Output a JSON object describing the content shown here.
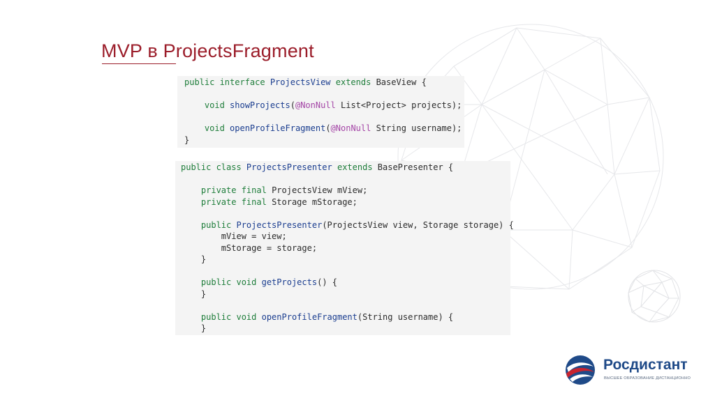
{
  "slide": {
    "title": "MVP в ProjectsFragment"
  },
  "code_block_1": [
    [
      [
        "kw",
        "public interface "
      ],
      [
        "tp",
        "ProjectsView"
      ],
      [
        "kw",
        " extends "
      ],
      [
        "p",
        "BaseView {"
      ]
    ],
    [],
    [
      [
        "p",
        "    "
      ],
      [
        "kw",
        "void "
      ],
      [
        "fn",
        "showProjects"
      ],
      [
        "p",
        "("
      ],
      [
        "an",
        "@NonNull"
      ],
      [
        "p",
        " List<Project> projects);"
      ]
    ],
    [],
    [
      [
        "p",
        "    "
      ],
      [
        "kw",
        "void "
      ],
      [
        "fn",
        "openProfileFragment"
      ],
      [
        "p",
        "("
      ],
      [
        "an",
        "@NonNull"
      ],
      [
        "p",
        " String username);"
      ]
    ],
    [
      [
        "p",
        "}"
      ]
    ]
  ],
  "code_block_2": [
    [
      [
        "kw",
        "public class "
      ],
      [
        "tp",
        "ProjectsPresenter"
      ],
      [
        "kw",
        " extends "
      ],
      [
        "p",
        "BasePresenter {"
      ]
    ],
    [],
    [
      [
        "p",
        "    "
      ],
      [
        "kw",
        "private final "
      ],
      [
        "p",
        "ProjectsView mView;"
      ]
    ],
    [
      [
        "p",
        "    "
      ],
      [
        "kw",
        "private final "
      ],
      [
        "p",
        "Storage mStorage;"
      ]
    ],
    [],
    [
      [
        "p",
        "    "
      ],
      [
        "kw",
        "public "
      ],
      [
        "fn",
        "ProjectsPresenter"
      ],
      [
        "p",
        "(ProjectsView view, Storage storage) {"
      ]
    ],
    [
      [
        "p",
        "        mView = view;"
      ]
    ],
    [
      [
        "p",
        "        mStorage = storage;"
      ]
    ],
    [
      [
        "p",
        "    }"
      ]
    ],
    [],
    [
      [
        "p",
        "    "
      ],
      [
        "kw",
        "public void "
      ],
      [
        "fn",
        "getProjects"
      ],
      [
        "p",
        "() {"
      ]
    ],
    [
      [
        "p",
        "    }"
      ]
    ],
    [],
    [
      [
        "p",
        "    "
      ],
      [
        "kw",
        "public void "
      ],
      [
        "fn",
        "openProfileFragment"
      ],
      [
        "p",
        "(String username) {"
      ]
    ],
    [
      [
        "p",
        "    }"
      ]
    ]
  ],
  "logo": {
    "name": "Росдистант",
    "tagline": "ВЫСШЕЕ ОБРАЗОВАНИЕ ДИСТАНЦИОННО",
    "icon": "rosdistant-emblem-icon"
  },
  "colors": {
    "title": "#9b1d2a",
    "keyword": "#1e7d3a",
    "type": "#1a3d8f",
    "annotation": "#a445a6",
    "code_background": "#f4f4f4",
    "logo_blue": "#1f4a88",
    "logo_red": "#c8242f"
  }
}
